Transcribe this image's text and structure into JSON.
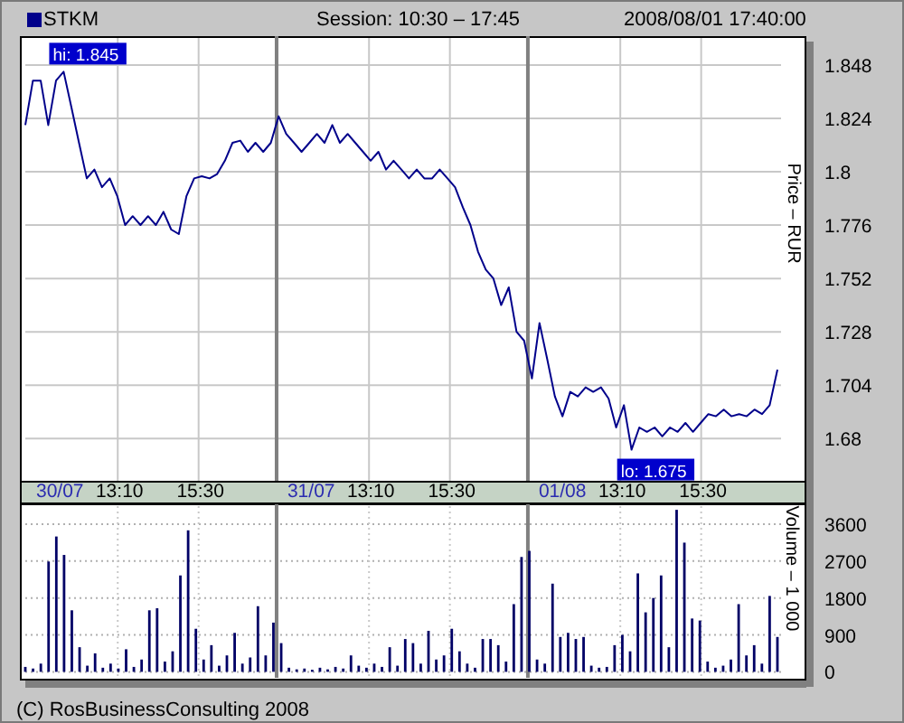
{
  "header": {
    "session": "Session: 10:30 – 17:45",
    "timestamp": "2008/08/01 17:40:00"
  },
  "price_chart": {
    "chart_data": {
      "type": "line",
      "ylabel": "Price – RUR",
      "ylim": [
        1.661,
        1.861
      ],
      "yticks": [
        1.68,
        1.704,
        1.728,
        1.752,
        1.776,
        1.8,
        1.824,
        1.848
      ],
      "categories": [
        null,
        null,
        null,
        null,
        null,
        null,
        null,
        null,
        null,
        null,
        null,
        null,
        null,
        null,
        null,
        null,
        null,
        null,
        null,
        null,
        null,
        null,
        null,
        null,
        null,
        null,
        null,
        null,
        null,
        null,
        null,
        null,
        null,
        null,
        null,
        null,
        null,
        null,
        null,
        null,
        null,
        null,
        null,
        null,
        null,
        null,
        null,
        null,
        null,
        null,
        null,
        null,
        null,
        null,
        null,
        null,
        null,
        null,
        null,
        null,
        null,
        null,
        null,
        null,
        null,
        null,
        null,
        null,
        null,
        null,
        null,
        null,
        null,
        null,
        null,
        null,
        null,
        null,
        null,
        null,
        null,
        null,
        null,
        null,
        null,
        null,
        null,
        null,
        null,
        null,
        null,
        null,
        null,
        null,
        null,
        null,
        null,
        null,
        null
      ],
      "series": [
        {
          "name": "STKM",
          "color": "#00008b",
          "values": [
            1.821,
            1.841,
            1.841,
            1.821,
            1.841,
            1.845,
            1.829,
            1.813,
            1.797,
            1.801,
            1.793,
            1.797,
            1.789,
            1.776,
            1.78,
            1.776,
            1.78,
            1.776,
            1.782,
            1.774,
            1.772,
            1.789,
            1.797,
            1.798,
            1.797,
            1.799,
            1.805,
            1.813,
            1.814,
            1.809,
            1.813,
            1.809,
            1.813,
            1.825,
            1.817,
            1.813,
            1.809,
            1.813,
            1.817,
            1.813,
            1.821,
            1.813,
            1.817,
            1.813,
            1.809,
            1.805,
            1.809,
            1.801,
            1.805,
            1.801,
            1.797,
            1.801,
            1.797,
            1.797,
            1.801,
            1.797,
            1.793,
            1.784,
            1.776,
            1.764,
            1.756,
            1.752,
            1.74,
            1.748,
            1.728,
            1.724,
            1.707,
            1.732,
            1.716,
            1.699,
            1.69,
            1.701,
            1.699,
            1.703,
            1.701,
            1.703,
            1.698,
            1.685,
            1.695,
            1.675,
            1.685,
            1.683,
            1.685,
            1.681,
            1.685,
            1.683,
            1.687,
            1.683,
            1.687,
            1.691,
            1.69,
            1.693,
            1.69,
            1.691,
            1.69,
            1.693,
            1.691,
            1.695,
            1.711
          ]
        }
      ],
      "grid": true
    },
    "markers": [
      {
        "kind": "high",
        "text": "hi: 1.845"
      },
      {
        "kind": "low",
        "text": "lo: 1.675"
      }
    ]
  },
  "time_axis": [
    {
      "kind": "date",
      "label": "30/07"
    },
    {
      "kind": "time",
      "label": "13:10"
    },
    {
      "kind": "time",
      "label": "15:30"
    },
    {
      "kind": "date",
      "label": "31/07"
    },
    {
      "kind": "time",
      "label": "13:10"
    },
    {
      "kind": "time",
      "label": "15:30"
    },
    {
      "kind": "date",
      "label": "01/08"
    },
    {
      "kind": "time",
      "label": "13:10"
    },
    {
      "kind": "time",
      "label": "15:30"
    }
  ],
  "volume_chart": {
    "chart_data": {
      "type": "bar",
      "ylabel": "Volume – 1 000",
      "ylim": [
        -190,
        4085
      ],
      "grid": true,
      "yticks": [
        0,
        900,
        1800,
        2700,
        3600
      ],
      "categories": [
        null,
        null,
        null,
        null,
        null,
        null,
        null,
        null,
        null,
        null,
        null,
        null,
        null,
        null,
        null,
        null,
        null,
        null,
        null,
        null,
        null,
        null,
        null,
        null,
        null,
        null,
        null,
        null,
        null,
        null,
        null,
        null,
        null,
        null,
        null,
        null,
        null,
        null,
        null,
        null,
        null,
        null,
        null,
        null,
        null,
        null,
        null,
        null,
        null,
        null,
        null,
        null,
        null,
        null,
        null,
        null,
        null,
        null,
        null,
        null,
        null,
        null,
        null,
        null,
        null,
        null,
        null,
        null,
        null,
        null,
        null,
        null,
        null,
        null,
        null,
        null,
        null,
        null,
        null,
        null,
        null,
        null,
        null,
        null,
        null,
        null,
        null,
        null,
        null,
        null,
        null,
        null,
        null,
        null,
        null,
        null,
        null,
        null
      ],
      "series": [
        {
          "color": "#000066",
          "values": [
            120,
            80,
            200,
            2690,
            3300,
            2850,
            1500,
            600,
            150,
            450,
            100,
            200,
            80,
            550,
            120,
            300,
            1500,
            1550,
            250,
            500,
            2350,
            3450,
            1050,
            300,
            650,
            150,
            400,
            950,
            200,
            350,
            1600,
            400,
            1200,
            700,
            100,
            60,
            80,
            50,
            100,
            60,
            120,
            80,
            400,
            150,
            100,
            200,
            120,
            600,
            150,
            800,
            700,
            200,
            1000,
            300,
            400,
            1050,
            500,
            200,
            100,
            800,
            800,
            650,
            250,
            1650,
            2800,
            2950,
            300,
            200,
            2150,
            850,
            950,
            800,
            850,
            150,
            100,
            120,
            650,
            900,
            500,
            2400,
            1450,
            1800,
            2350,
            600,
            3950,
            3150,
            1300,
            1250,
            250,
            100,
            150,
            300,
            1650,
            400,
            650,
            200,
            1850,
            850
          ]
        }
      ]
    }
  },
  "footer": "(C) RosBusinessConsulting 2008"
}
